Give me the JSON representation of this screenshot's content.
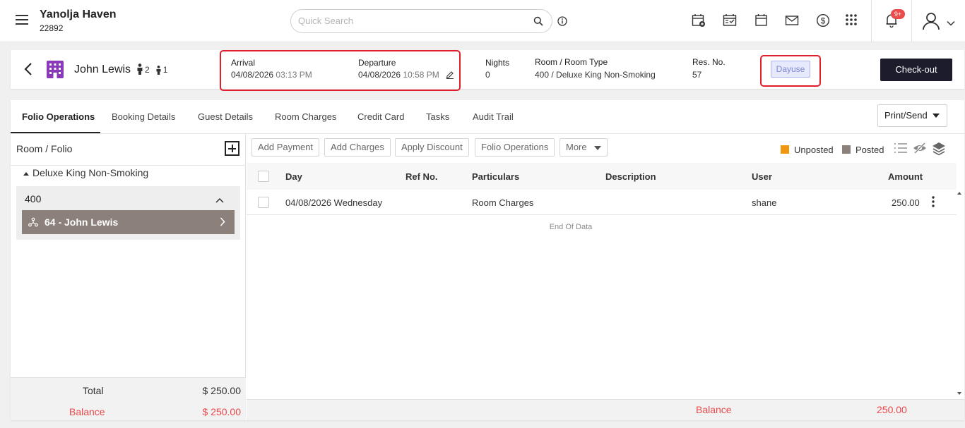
{
  "app": {
    "hotel_name": "Yanolja Haven",
    "hotel_code": "22892",
    "search_placeholder": "Quick Search",
    "notification_badge": "9+",
    "icons": [
      "menu-icon",
      "search-icon",
      "info-icon",
      "add-reservation-icon",
      "calendar-check-icon",
      "calendar-icon",
      "mail-icon",
      "dollar-icon",
      "apps-grid-icon",
      "bell-icon",
      "user-icon"
    ]
  },
  "reservation": {
    "guest_name": "John Lewis",
    "adults": "2",
    "children": "1",
    "arrival_label": "Arrival",
    "arrival_date": "04/08/2026",
    "arrival_time": "03:13 PM",
    "departure_label": "Departure",
    "departure_date": "04/08/2026",
    "departure_time": "10:58 PM",
    "nights_label": "Nights",
    "nights_value": "0",
    "room_label": "Room / Room Type",
    "room_value": "400 / Deluxe King Non-Smoking",
    "resno_label": "Res. No.",
    "resno_value": "57",
    "status_badge": "Dayuse",
    "checkout_label": "Check-out"
  },
  "tabs": [
    {
      "label": "Folio Operations",
      "active": true
    },
    {
      "label": "Booking Details"
    },
    {
      "label": "Guest Details"
    },
    {
      "label": "Room Charges"
    },
    {
      "label": "Credit Card"
    },
    {
      "label": "Tasks"
    },
    {
      "label": "Audit Trail"
    }
  ],
  "print_send_label": "Print/Send",
  "left_panel": {
    "title": "Room / Folio",
    "room_type": "Deluxe King Non-Smoking",
    "room_number": "400",
    "folio_label": "64 - John Lewis",
    "total_label": "Total",
    "total_value": "$ 250.00",
    "balance_label": "Balance",
    "balance_value": "$ 250.00"
  },
  "toolbar": {
    "add_payment": "Add Payment",
    "add_charges": "Add Charges",
    "apply_discount": "Apply Discount",
    "folio_operations": "Folio Operations",
    "more": "More",
    "legend_unposted": "Unposted",
    "legend_posted": "Posted",
    "unposted_color": "#f0960f",
    "posted_color": "#8c807b"
  },
  "table": {
    "headers": [
      "Day",
      "Ref No.",
      "Particulars",
      "Description",
      "User",
      "Amount"
    ],
    "rows": [
      {
        "day": "04/08/2026 Wednesday",
        "ref": "",
        "particulars": "Room Charges",
        "description": "",
        "user": "shane",
        "amount": "250.00"
      }
    ],
    "end_of_data": "End Of Data",
    "balance_label": "Balance",
    "balance_value": "250.00"
  }
}
